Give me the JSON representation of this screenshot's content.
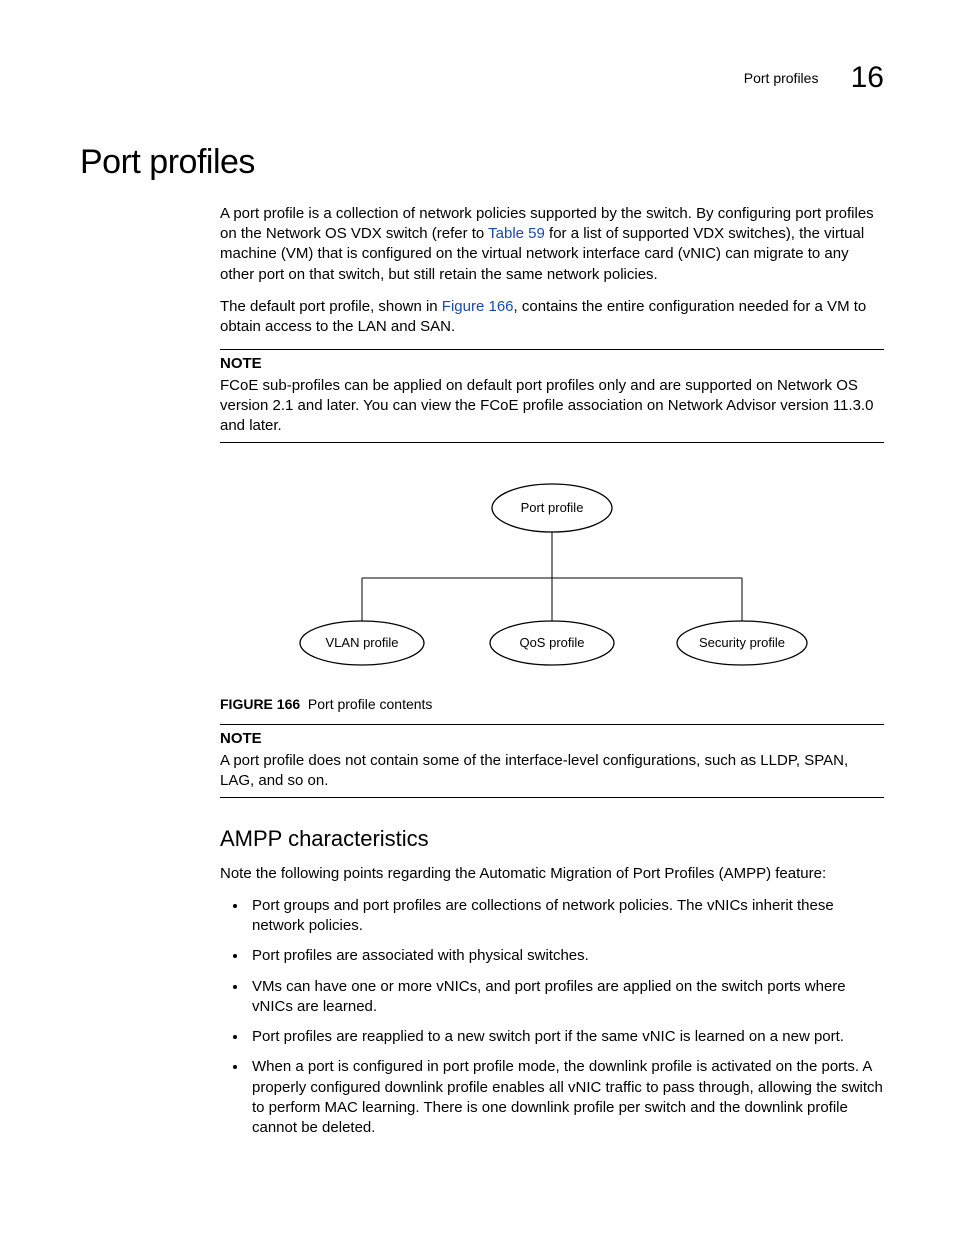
{
  "header": {
    "running_title": "Port profiles",
    "chapter_num": "16"
  },
  "title": "Port profiles",
  "para1": {
    "pre": "A port profile is a collection of network policies supported by the switch. By configuring port profiles on the Network OS VDX switch (refer to ",
    "link": "Table 59",
    "post": " for a list of supported VDX switches), the virtual machine (VM) that is configured on the virtual network interface card (vNIC) can migrate to any other port on that switch, but still retain the same network policies."
  },
  "para2": {
    "pre": "The default port profile, shown in ",
    "link": "Figure 166",
    "post": ", contains the entire configuration needed for a VM to obtain access to the LAN and SAN."
  },
  "note1": {
    "label": "NOTE",
    "text": "FCoE sub-profiles can be applied on default port profiles only and are supported on Network OS version 2.1 and later. You can view the FCoE profile association on Network Advisor version 11.3.0 and later."
  },
  "diagram": {
    "top": "Port profile",
    "left": "VLAN profile",
    "mid": "QoS profile",
    "right": "Security profile"
  },
  "figcap": {
    "label": "FIGURE 166",
    "text": "Port profile contents"
  },
  "note2": {
    "label": "NOTE",
    "text": "A port profile does not contain some of the interface-level configurations, such as LLDP, SPAN, LAG, and so on."
  },
  "subhead": "AMPP characteristics",
  "intro2": "Note the following points regarding the Automatic Migration of Port Profiles (AMPP) feature:",
  "bullets": [
    "Port groups and port profiles are collections of network policies. The vNICs inherit these network policies.",
    "Port profiles are associated with physical switches.",
    "VMs can have one or more vNICs, and port profiles are applied on the switch ports where vNICs are learned.",
    "Port profiles are reapplied to a new switch port if the same vNIC is learned on a new port.",
    "When a port is configured in port profile mode, the downlink profile is activated on the ports. A properly configured downlink profile enables all vNIC traffic to pass through, allowing the switch to perform MAC learning. There is one downlink profile per switch and the downlink profile cannot be deleted."
  ]
}
